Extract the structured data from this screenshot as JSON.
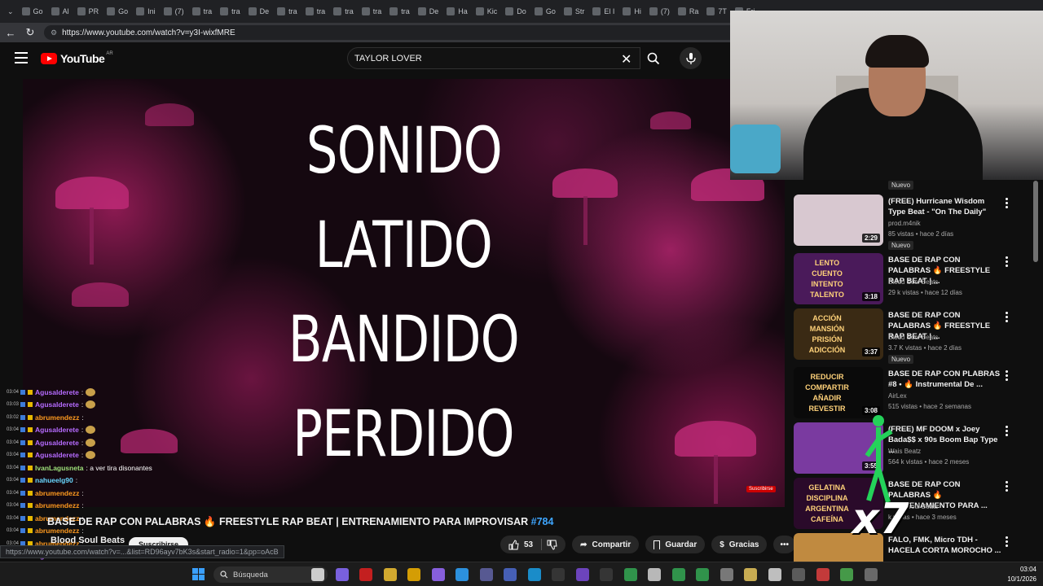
{
  "browser": {
    "tabs": [
      "Go",
      "Al",
      "PR",
      "Go",
      "Ini",
      "(7)",
      "tra",
      "tra",
      "De",
      "tra",
      "tra",
      "tra",
      "tra",
      "tra",
      "De",
      "Ha",
      "Kic",
      "Do",
      "Go",
      "Str",
      "El I",
      "Hi",
      "(7)",
      "Ra",
      "7T",
      "Fri"
    ],
    "url": "https://www.youtube.com/watch?v=y3I-wixfMRE"
  },
  "youtube": {
    "logo_text": "YouTube",
    "region": "AR",
    "search_value": "TAYLOR LOVER"
  },
  "video": {
    "words": [
      "SONIDO",
      "LATIDO",
      "BANDIDO",
      "PERDIDO"
    ],
    "mini_label": "Suscribirse",
    "title_main": "BASE DE RAP CON PALABRAS 🔥 FREESTYLE RAP BEAT | ENTRENAMIENTO PARA IMPROVISAR ",
    "title_tag": "#784",
    "channel": "Blood Soul Beats",
    "subscribe": "Suscribirse",
    "likes": "53",
    "share": "Compartir",
    "save": "Guardar",
    "thanks": "Gracias",
    "hover_url": "https://www.youtube.com/watch?v=...&list=RD96ayv7bK3s&start_radio=1&pp=oAcB"
  },
  "chat": [
    {
      "time": "03:04",
      "user": "Agusalderete",
      "msg": ":",
      "color": "#b66bff",
      "emote": true
    },
    {
      "time": "03:03",
      "user": "Agusalderete",
      "msg": ":",
      "color": "#b66bff",
      "emote": true
    },
    {
      "time": "03:02",
      "user": "abrumendezz",
      "msg": ":",
      "color": "#ff9a1f",
      "emote": false
    },
    {
      "time": "03:04",
      "user": "Agusalderete",
      "msg": ":",
      "color": "#b66bff",
      "emote": true
    },
    {
      "time": "03:04",
      "user": "Agusalderete",
      "msg": ":",
      "color": "#b66bff",
      "emote": true
    },
    {
      "time": "03:04",
      "user": "Agusalderete",
      "msg": ":",
      "color": "#b66bff",
      "emote": true
    },
    {
      "time": "03:04",
      "user": "IvanLagusneta",
      "msg": ": a ver tira disonantes",
      "color": "#9ee07a",
      "emote": false
    },
    {
      "time": "03:04",
      "user": "nahueelg90",
      "msg": ":",
      "color": "#6ad7ff",
      "emote": false
    },
    {
      "time": "03:04",
      "user": "abrumendezz",
      "msg": ":",
      "color": "#ff9a1f",
      "emote": false
    },
    {
      "time": "03:04",
      "user": "abrumendezz",
      "msg": ":",
      "color": "#ff9a1f",
      "emote": false
    },
    {
      "time": "03:04",
      "user": "abrumendezz",
      "msg": ":",
      "color": "#ff9a1f",
      "emote": false
    },
    {
      "time": "03:04",
      "user": "abrumendezz",
      "msg": ":",
      "color": "#ff9a1f",
      "emote": false
    },
    {
      "time": "03:04",
      "user": "abrumendezz",
      "msg": ":",
      "color": "#ff9a1f",
      "emote": false
    },
    {
      "time": "03:04",
      "user": "Agusalderete",
      "msg": ":",
      "color": "#b66bff",
      "emote": false
    },
    {
      "time": "03:04",
      "user": "Agusalderete",
      "msg": ":",
      "color": "#b66bff",
      "emote": false
    }
  ],
  "sidebar": {
    "top_badge": "Nuevo",
    "items": [
      {
        "title": "(FREE) Hurricane Wisdom Type Beat - \"On The Daily\"",
        "channel": "prod.m4nik",
        "meta": "85 vistas • hace 2 días",
        "badge": "Nuevo",
        "duration": "2:29",
        "thumb_text": "",
        "thumb_color": "#d8c8d0"
      },
      {
        "title": "BASE DE RAP CON PALABRAS 🔥 FREESTYLE RAP BEAT | ...",
        "channel": "Blood Soul Beats",
        "meta": "29 k vistas • hace 12 días",
        "badge": "",
        "duration": "3:18",
        "thumb_text": "LENTO CUENTO INTENTO TALENTO",
        "thumb_color": "#4a1a5a"
      },
      {
        "title": "BASE DE RAP CON PALABRAS 🔥 FREESTYLE RAP BEAT | ...",
        "channel": "Blood Soul Beats",
        "meta": "3.7 K vistas • hace 2 días",
        "badge": "Nuevo",
        "duration": "3:37",
        "thumb_text": "ACCIÓN MANSIÓN PRISIÓN ADICCIÓN",
        "thumb_color": "#3a2a14"
      },
      {
        "title": "BASE DE RAP CON PLABRAS #8 • 🔥 Instrumental De ...",
        "channel": "AirLex",
        "meta": "515 vistas • hace 2 semanas",
        "badge": "",
        "duration": "3:08",
        "thumb_text": "REDUCIR COMPARTIR AÑADIR REVESTIR",
        "thumb_color": "#0a0a0a"
      },
      {
        "title": "(FREE) MF DOOM x Joey Bada$$ x 90s Boom Bap Type ...",
        "channel": "Wais Beatz",
        "meta": "564 k vistas • hace 2 meses",
        "badge": "",
        "duration": "3:55",
        "thumb_text": "",
        "thumb_color": "#7a3aa0"
      },
      {
        "title": "BASE DE RAP CON PALABRAS 🔥 ENTRENAMIENTO PARA ...",
        "channel": "Blood Soul Beats",
        "meta": "k vistas • hace 3 meses",
        "badge": "",
        "duration": "",
        "thumb_text": "GELATINA DISCIPLINA ARGENTINA CAFEÍNA",
        "thumb_color": "#2a0a2a"
      },
      {
        "title": "FALO, FMK, Micro TDH - HACELA CORTA MOROCHO ...",
        "channel": "",
        "meta": "",
        "badge": "",
        "duration": "",
        "thumb_text": "",
        "thumb_color": "#c08a40"
      }
    ]
  },
  "overlay_text": "x7",
  "taskbar": {
    "search_label": "Búsqueda",
    "time": "03:04",
    "date": "10/1/2026"
  },
  "colors": {
    "accent_red": "#ff0000",
    "link_blue": "#3ea6ff",
    "bg": "#0f0f0f"
  }
}
